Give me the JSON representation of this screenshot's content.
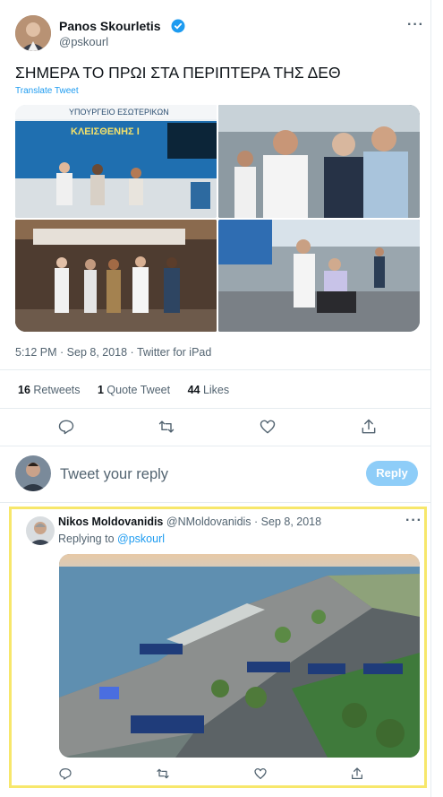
{
  "colors": {
    "accent": "#1d9bf0",
    "reply_disabled": "#8ecdf8",
    "highlight": "#f7e76b",
    "muted": "#536471"
  },
  "tweet": {
    "author_name": "Panos Skourletis",
    "author_handle": "@pskourl",
    "verified_icon": "verified-badge-icon",
    "text": "ΣΗΜΕΡΑ ΤΟ ΠΡΩΙ ΣΤΑ ΠΕΡΙΠΤΕΡΑ ΤΗΣ ΔΕΘ",
    "translate_label": "Translate Tweet",
    "photo1_banner_title": "ΥΠΟΥΡΓΕΙΟ ΕΣΩΤΕΡΙΚΩΝ",
    "photo1_banner_name": "ΚΛΕΙΣΘΕΝΗΣ Ι",
    "timestamp": "5:12 PM · Sep 8, 2018 · Twitter for iPad",
    "stats": {
      "retweets_count": "16",
      "retweets_label": "Retweets",
      "quotes_count": "1",
      "quotes_label": "Quote Tweet",
      "likes_count": "44",
      "likes_label": "Likes"
    }
  },
  "reply_box": {
    "placeholder": "Tweet your reply",
    "button_label": "Reply"
  },
  "reply_tweet": {
    "author_name": "Nikos Moldovanidis",
    "author_handle": "@NMoldovanidis",
    "date": "· Sep 8, 2018",
    "replying_prefix": "Replying to",
    "replying_handle": "@pskourl"
  },
  "icons": [
    "reply-icon",
    "retweet-icon",
    "like-icon",
    "share-icon",
    "more-icon"
  ]
}
